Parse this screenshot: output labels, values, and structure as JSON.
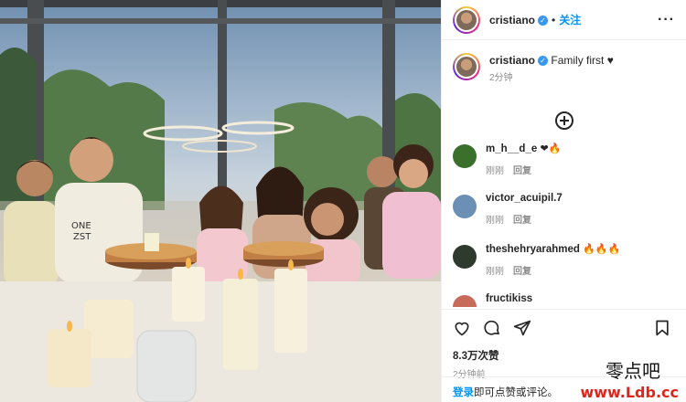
{
  "header": {
    "username": "cristiano",
    "follow_label": "关注",
    "more_label": "···"
  },
  "caption": {
    "username": "cristiano",
    "text": "Family first ♥",
    "time": "2分钟"
  },
  "comments": [
    {
      "user": "m_h__d_e",
      "text": "❤🔥",
      "time": "刚刚",
      "reply": "回复",
      "avatar_color": "#3a6f2c"
    },
    {
      "user": "victor_acuipil.7",
      "text": "",
      "time": "刚刚",
      "reply": "回复",
      "avatar_color": "#6b8fb5"
    },
    {
      "user": "theshehryarahmed",
      "text": "🔥🔥🔥",
      "time": "刚刚",
      "reply": "回复",
      "avatar_color": "#2f3a2f"
    },
    {
      "user": "fructikiss",
      "text": "",
      "time": "",
      "reply": "",
      "avatar_color": "#c86a5a"
    }
  ],
  "actions": {
    "likes": "8.3万次赞",
    "time_ago": "2分钟前"
  },
  "login_bar": {
    "link": "登录",
    "text": "即可点赞或评论。"
  },
  "watermark": {
    "cn": "零点吧",
    "url": "www.Ldb.cc"
  },
  "colors": {
    "accent": "#0095f6",
    "verified": "#3897f0",
    "watermark": "#e2231a"
  }
}
